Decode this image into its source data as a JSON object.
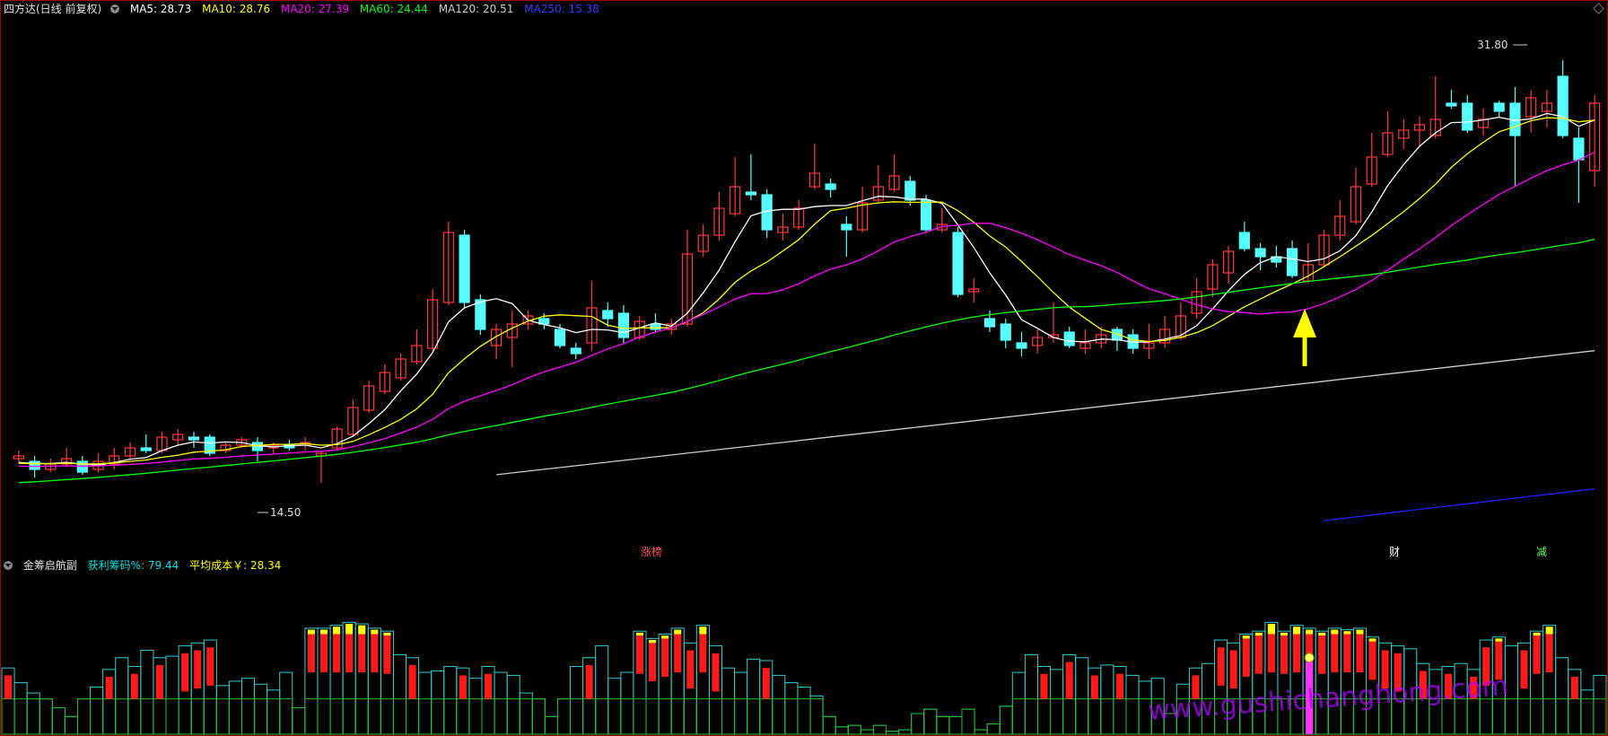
{
  "main_header": {
    "title": "四方达(日线 前复权)",
    "ma5": "MA5: 28.73",
    "ma10": "MA10: 28.76",
    "ma20": "MA20: 27.39",
    "ma60": "MA60: 24.44",
    "ma120": "MA120: 20.51",
    "ma250": "MA250: 15.38"
  },
  "sub_header": {
    "title": "金筹启航副",
    "profit": "获利筹码%: 79.44",
    "avgcost": "平均成本￥: 28.34"
  },
  "annotations": {
    "high_label": "31.80",
    "low_label": "14.50",
    "tag_zt": "涨榜",
    "tag_cai": "财",
    "tag_jian": "减",
    "watermark": "www.gushichanghong.com"
  },
  "colors": {
    "up": "#ff3b3b",
    "down": "#55ffff",
    "ma5": "#ffffff",
    "ma10": "#ffff00",
    "ma20": "#ff00ff",
    "ma60": "#00ff00",
    "ma120": "#cccccc",
    "ma250": "#2222ff",
    "arrow": "#ffff00"
  },
  "chart_data": [
    {
      "type": "candlestick",
      "title": "四方达(日线 前复权)",
      "ylim": [
        13.6,
        32.8
      ],
      "candles": [
        [
          16.5,
          16.6,
          16.8,
          16.3
        ],
        [
          16.4,
          16.1,
          16.6,
          15.8
        ],
        [
          16.1,
          16.3,
          16.5,
          16.0
        ],
        [
          16.3,
          16.5,
          16.9,
          16.2
        ],
        [
          16.4,
          16.0,
          16.6,
          15.9
        ],
        [
          16.1,
          16.4,
          16.7,
          16.0
        ],
        [
          16.3,
          16.6,
          16.9,
          16.1
        ],
        [
          16.6,
          16.9,
          17.1,
          16.5
        ],
        [
          16.9,
          16.8,
          17.4,
          16.7
        ],
        [
          16.8,
          17.3,
          17.5,
          16.7
        ],
        [
          17.2,
          17.4,
          17.6,
          17.0
        ],
        [
          17.3,
          17.2,
          17.5,
          16.9
        ],
        [
          17.3,
          16.7,
          17.4,
          16.6
        ],
        [
          16.8,
          17.0,
          17.1,
          16.7
        ],
        [
          17.0,
          17.2,
          17.3,
          16.9
        ],
        [
          17.1,
          16.8,
          17.3,
          16.4
        ],
        [
          16.9,
          17.0,
          17.1,
          16.7
        ],
        [
          17.0,
          16.9,
          17.2,
          16.8
        ],
        [
          17.0,
          17.1,
          17.3,
          16.8
        ],
        [
          16.6,
          16.7,
          16.8,
          15.6
        ],
        [
          16.9,
          17.6,
          17.7,
          16.8
        ],
        [
          17.4,
          18.4,
          18.7,
          17.3
        ],
        [
          18.3,
          19.2,
          19.4,
          18.2
        ],
        [
          19.0,
          19.7,
          20.0,
          18.9
        ],
        [
          19.5,
          20.2,
          20.4,
          19.4
        ],
        [
          20.1,
          20.7,
          21.3,
          20.0
        ],
        [
          20.6,
          22.4,
          22.8,
          20.5
        ],
        [
          22.3,
          24.9,
          25.3,
          22.2
        ],
        [
          24.8,
          22.3,
          25.0,
          22.1
        ],
        [
          22.4,
          21.3,
          22.6,
          21.1
        ],
        [
          20.7,
          21.3,
          21.5,
          20.2
        ],
        [
          21.0,
          21.5,
          22.0,
          19.9
        ],
        [
          21.5,
          21.8,
          22.0,
          21.3
        ],
        [
          21.7,
          21.5,
          21.9,
          21.3
        ],
        [
          21.3,
          20.7,
          21.5,
          20.6
        ],
        [
          20.6,
          20.4,
          20.8,
          20.2
        ],
        [
          20.8,
          22.1,
          23.1,
          20.5
        ],
        [
          22.0,
          21.7,
          22.3,
          21.4
        ],
        [
          21.9,
          21.0,
          22.2,
          20.8
        ],
        [
          21.0,
          21.6,
          21.8,
          20.9
        ],
        [
          21.5,
          21.3,
          21.9,
          21.2
        ],
        [
          21.3,
          21.5,
          21.7,
          21.1
        ],
        [
          21.5,
          24.1,
          25.0,
          21.4
        ],
        [
          24.2,
          24.8,
          25.2,
          24.0
        ],
        [
          24.8,
          25.8,
          26.4,
          24.6
        ],
        [
          25.6,
          26.6,
          27.7,
          25.5
        ],
        [
          26.4,
          26.3,
          27.8,
          26.1
        ],
        [
          26.3,
          25.0,
          26.5,
          24.7
        ],
        [
          24.9,
          25.1,
          25.6,
          24.6
        ],
        [
          25.1,
          25.8,
          26.1,
          25.0
        ],
        [
          26.6,
          27.1,
          28.2,
          26.5
        ],
        [
          26.7,
          26.5,
          26.9,
          26.2
        ],
        [
          25.2,
          25.0,
          25.5,
          24.0
        ],
        [
          25.0,
          26.0,
          26.6,
          24.9
        ],
        [
          26.1,
          26.6,
          27.4,
          26.0
        ],
        [
          26.5,
          27.0,
          27.8,
          26.4
        ],
        [
          26.8,
          26.1,
          27.0,
          25.9
        ],
        [
          26.1,
          25.0,
          26.3,
          24.9
        ],
        [
          25.0,
          25.2,
          25.8,
          24.9
        ],
        [
          24.9,
          22.6,
          25.1,
          22.5
        ],
        [
          22.7,
          22.8,
          23.2,
          22.3
        ],
        [
          21.7,
          21.4,
          22.0,
          21.2
        ],
        [
          21.5,
          20.9,
          21.7,
          20.6
        ],
        [
          20.8,
          20.6,
          21.2,
          20.3
        ],
        [
          20.7,
          21.0,
          21.3,
          20.4
        ],
        [
          21.0,
          21.1,
          22.3,
          20.8
        ],
        [
          21.2,
          20.7,
          21.4,
          20.6
        ],
        [
          20.6,
          20.8,
          21.3,
          20.4
        ],
        [
          20.8,
          21.1,
          21.4,
          20.6
        ],
        [
          21.3,
          20.9,
          21.4,
          20.5
        ],
        [
          21.1,
          20.6,
          21.3,
          20.4
        ],
        [
          20.6,
          20.8,
          21.5,
          20.2
        ],
        [
          20.8,
          21.3,
          21.8,
          20.6
        ],
        [
          21.0,
          21.8,
          22.3,
          20.9
        ],
        [
          21.9,
          22.7,
          23.2,
          21.7
        ],
        [
          22.8,
          23.7,
          23.9,
          22.5
        ],
        [
          23.4,
          24.2,
          24.4,
          23.0
        ],
        [
          24.9,
          24.3,
          25.3,
          24.2
        ],
        [
          24.3,
          24.0,
          24.5,
          23.5
        ],
        [
          24.0,
          23.8,
          24.4,
          23.6
        ],
        [
          24.3,
          23.3,
          24.6,
          23.2
        ],
        [
          23.1,
          23.7,
          24.5,
          23.0
        ],
        [
          23.7,
          24.8,
          25.0,
          23.6
        ],
        [
          24.8,
          25.5,
          26.1,
          24.6
        ],
        [
          25.3,
          26.6,
          27.3,
          25.2
        ],
        [
          26.7,
          27.7,
          28.6,
          26.6
        ],
        [
          27.8,
          28.6,
          29.4,
          27.7
        ],
        [
          28.4,
          28.7,
          29.1,
          28.0
        ],
        [
          28.7,
          28.9,
          29.2,
          28.1
        ],
        [
          28.5,
          29.1,
          30.7,
          28.4
        ],
        [
          29.7,
          29.6,
          30.2,
          29.5
        ],
        [
          29.7,
          28.7,
          30.0,
          28.6
        ],
        [
          28.8,
          29.1,
          29.5,
          28.5
        ],
        [
          29.7,
          29.4,
          29.8,
          29.2
        ],
        [
          29.7,
          28.5,
          30.3,
          26.6
        ],
        [
          29.2,
          29.9,
          30.2,
          28.6
        ],
        [
          29.4,
          29.7,
          30.2,
          28.8
        ],
        [
          30.7,
          28.5,
          31.3,
          28.4
        ],
        [
          28.4,
          27.6,
          28.8,
          26.0
        ],
        [
          27.2,
          29.7,
          30.0,
          26.6
        ]
      ],
      "ma_lines": [
        {
          "name": "MA5",
          "value": 28.73
        },
        {
          "name": "MA10",
          "value": 28.76
        },
        {
          "name": "MA20",
          "value": 27.39
        },
        {
          "name": "MA60",
          "value": 24.44
        },
        {
          "name": "MA120",
          "value": 20.51
        },
        {
          "name": "MA250",
          "value": 15.38
        }
      ],
      "high": 31.8,
      "low": 14.5
    },
    {
      "type": "bar",
      "title": "金筹启航副",
      "ylim": [
        0,
        100
      ],
      "profit_pct": 79.44,
      "avg_cost": 28.34,
      "values": [
        45,
        35,
        28,
        24,
        18,
        12,
        24,
        32,
        44,
        52,
        46,
        57,
        52,
        53,
        60,
        62,
        64,
        33,
        36,
        38,
        34,
        30,
        42,
        18,
        72,
        72,
        74,
        76,
        75,
        72,
        70,
        54,
        52,
        42,
        43,
        46,
        45,
        38,
        46,
        42,
        40,
        28,
        24,
        12,
        24,
        46,
        52,
        60,
        38,
        42,
        70,
        65,
        68,
        72,
        62,
        74,
        60,
        45,
        42,
        51,
        50,
        40,
        35,
        32,
        26,
        12,
        5,
        6,
        3,
        6,
        2,
        3,
        14,
        17,
        12,
        12,
        17,
        3,
        7,
        19,
        42,
        54,
        46,
        44,
        54,
        52,
        45,
        47,
        46,
        40,
        36,
        38,
        14,
        34,
        45,
        48,
        64,
        62,
        68,
        70,
        76,
        70,
        74,
        72,
        70,
        72,
        71,
        72,
        66,
        62,
        60,
        58,
        48,
        44,
        46,
        48,
        44,
        64,
        66,
        60,
        62,
        70,
        74,
        52,
        44,
        30,
        40
      ],
      "profit_marks": [
        0,
        0,
        0,
        0,
        0,
        0,
        0,
        0,
        28,
        0,
        0,
        0,
        0,
        0,
        0,
        0,
        0,
        0,
        28,
        0,
        24,
        0,
        0,
        0,
        0,
        0,
        0,
        0,
        0,
        0,
        0,
        0,
        0,
        0,
        0,
        0,
        0,
        0,
        0,
        0,
        0,
        0,
        0,
        0,
        0,
        0,
        0,
        0,
        0,
        0,
        0,
        0,
        0,
        0,
        0,
        0,
        0,
        0,
        0,
        0,
        0,
        0,
        0,
        0,
        0,
        0,
        0,
        0,
        0,
        0,
        0,
        0,
        0,
        0,
        0,
        0,
        0,
        0,
        0,
        0,
        0,
        0,
        0,
        0,
        0,
        0,
        0,
        0,
        0,
        0,
        0,
        0,
        0,
        0,
        0,
        0,
        0,
        0,
        0,
        0,
        0,
        0,
        0,
        0,
        0,
        0,
        0,
        0,
        0,
        0,
        0,
        0,
        0,
        0,
        0,
        0,
        0,
        0,
        0,
        0,
        0,
        0,
        0,
        0,
        0,
        0,
        0
      ]
    }
  ]
}
